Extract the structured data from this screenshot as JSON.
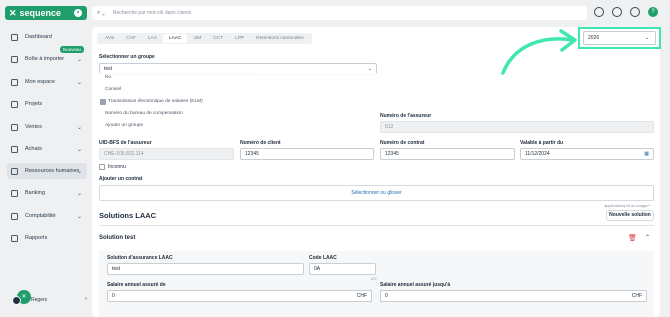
{
  "app": {
    "brand": "sequence"
  },
  "sidebar": {
    "items": [
      {
        "label": "Dashboard",
        "icon": "home-icon"
      },
      {
        "label": "Boîte à importer",
        "icon": "inbox-icon",
        "badge": "Nouveau"
      },
      {
        "label": "Mon espace",
        "icon": "user-icon"
      },
      {
        "label": "Projets",
        "icon": "check-square-icon"
      },
      {
        "label": "Ventes",
        "icon": "bag-icon"
      },
      {
        "label": "Achats",
        "icon": "cart-icon"
      },
      {
        "label": "Ressources humaines",
        "icon": "people-icon"
      },
      {
        "label": "Banking",
        "icon": "bank-icon"
      },
      {
        "label": "Comptabilité",
        "icon": "calculator-icon"
      },
      {
        "label": "Rapports",
        "icon": "chart-icon"
      }
    ],
    "user_name": "Regers"
  },
  "search": {
    "placeholder": "Recherche par mot-clé dans clients"
  },
  "year_select": {
    "value": "2026"
  },
  "tabs": [
    "AVS",
    "CAF",
    "LAA",
    "LAAC",
    "IJM",
    "CCT",
    "LPP",
    "Retentions cantonales"
  ],
  "form": {
    "group_label": "Sélectionner un groupe",
    "group_value": "test",
    "dropdown_items": [
      "No",
      "Conseil",
      "Transmission électronique de salaires (ELM)",
      "Numéro du bureau de compensation",
      "Ajouter un groupe"
    ],
    "insurer_number_label": "Numéro de l'assureur",
    "insurer_number_value": "512",
    "uid_label": "UID-BFS de l'assureur",
    "uid_value": "CHE-105.832.114",
    "client_number_label": "Numéro de client",
    "client_number_value": "12345",
    "contract_number_label": "Numéro de contrat",
    "contract_number_value": "12345",
    "valid_from_label": "Valable à partir du",
    "valid_from_value": "11/12/2024",
    "inconnu_label": "Inconnu",
    "add_contract_label": "Ajouter un contrat",
    "dropzone_text": "Sélectionner ou glisser",
    "dropzone_hint": "application/pdf ou image/*"
  },
  "solutions": {
    "title": "Solutions LAAC",
    "new_button": "Nouvelle solution",
    "solution_title": "Solution test",
    "insurance_label": "Solution d'assurance LAAC",
    "insurance_value": "test",
    "code_label": "Code LAAC",
    "code_value": "0A",
    "code_counter": "2/2",
    "salary_from_label": "Salaire annuel assuré de",
    "salary_from_value": "0",
    "salary_to_label": "Salaire annuel assuré jusqu'à",
    "salary_to_value": "0",
    "currency": "CHF"
  }
}
